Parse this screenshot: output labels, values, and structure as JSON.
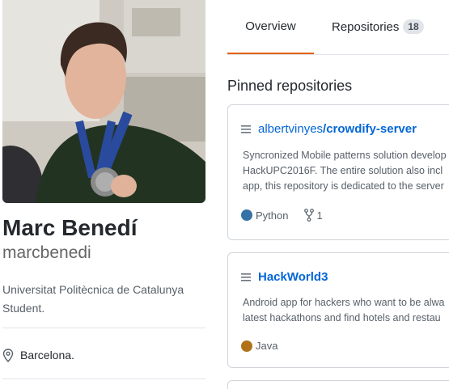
{
  "profile": {
    "avatar_alt": "avatar",
    "full_name": "Marc Benedí",
    "username": "marcbenedi",
    "bio": "Universitat Politècnica de Catalunya Student.",
    "location": "Barcelona."
  },
  "tabs": [
    {
      "label": "Overview",
      "active": true
    },
    {
      "label": "Repositories",
      "count": "18",
      "active": false
    }
  ],
  "pinned": {
    "title": "Pinned repositories",
    "repos": [
      {
        "owner": "albertvinyes",
        "separator": "/",
        "name": "crowdify-server",
        "description_lines": [
          "Syncronized Mobile patterns solution develop",
          "HackUPC2016F. The entire solution also incl",
          "app, this repository is dedicated to the server"
        ],
        "language": "Python",
        "language_color": "#3572A5",
        "forks": "1"
      },
      {
        "owner": "",
        "separator": "",
        "name": "HackWorld3",
        "description_lines": [
          "Android app for hackers who want to be alwa",
          "latest hackathons and find hotels and restau"
        ],
        "language": "Java",
        "language_color": "#b07219"
      }
    ]
  }
}
